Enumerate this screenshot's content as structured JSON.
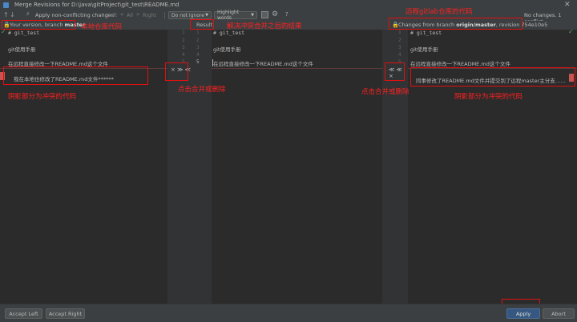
{
  "window": {
    "title": "Merge Revisions for D:\\java\\gitProject\\git_test\\README.md"
  },
  "toolbar": {
    "apply_non_conflicting": "Apply non-conflicting changes",
    "left": "Left",
    "all": "All",
    "right": "Right",
    "ignore_dropdown": "Do not ignore",
    "highlight_dropdown": "Highlight words",
    "help": "?",
    "status": "No changes. 1 conflict"
  },
  "panes": {
    "left": {
      "header_prefix": "Your version, branch ",
      "header_branch": "master",
      "lines": [
        "# git_test",
        "",
        "git使用手册",
        "",
        "在远程直接修改一下README.md这个文件",
        ""
      ],
      "conflict_line": "我在本地也修改了README.md文件******"
    },
    "center": {
      "header": "Result",
      "line_numbers": [
        "1",
        "2",
        "3",
        "4",
        "5"
      ],
      "lines": [
        "# git_test",
        "",
        "git使用手册",
        "",
        "在远程直接修改一下README.md这个文件"
      ]
    },
    "right": {
      "header_prefix": "Changes from branch ",
      "header_branch": "origin/master",
      "header_suffix": ", revision 754e10e5",
      "lines": [
        "# git_test",
        "",
        "git使用手册",
        "",
        "在远程直接修改一下README.md这个文件",
        ""
      ],
      "conflict_line": "同事修改了README.md文件并提交到了远程master主分支……"
    }
  },
  "gutter": {
    "left_numbers": [
      "1",
      "2",
      "3",
      "4",
      "5"
    ],
    "right_numbers": [
      "1",
      "2",
      "3",
      "4",
      "5"
    ],
    "left_controls": "× ≫ ≪",
    "right_controls": "≪ ≪ ×"
  },
  "annotations": {
    "local_repo": "本地仓库代码",
    "resolve_result": "解决冲突合并之后的结果",
    "remote_repo": "远程gitlab仓库的代码",
    "click_merge_left": "点击合并或删除",
    "click_merge_right": "点击合并或删除",
    "shadow_left": "阴影部分为冲突的代码",
    "shadow_right": "阴影部分为冲突的代码"
  },
  "bottom": {
    "accept_left": "Accept Left",
    "accept_right": "Accept Right",
    "apply": "Apply",
    "abort": "Abort"
  },
  "colors": {
    "accent": "#365880",
    "annotation": "#ff2020",
    "conflict_marker": "#c75450"
  }
}
